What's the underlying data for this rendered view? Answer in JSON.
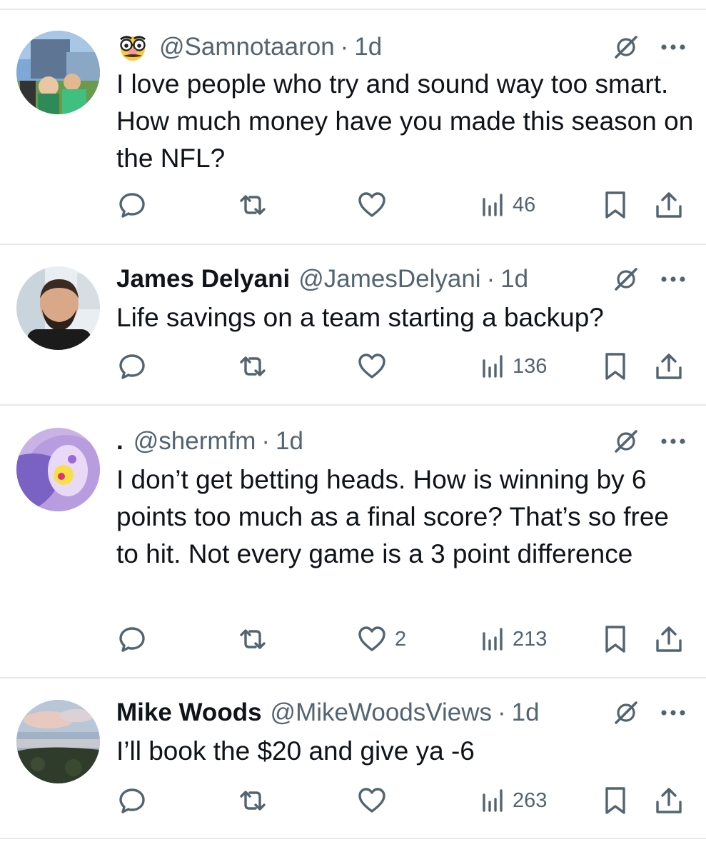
{
  "icons": {
    "reply": "reply-icon",
    "retweet": "retweet-icon",
    "like": "heart-icon",
    "views": "views-chart-icon",
    "bookmark": "bookmark-icon",
    "share": "share-icon",
    "grok": "grok-icon",
    "more": "more-icon"
  },
  "colors": {
    "text": "#0f1419",
    "secondary": "#536471",
    "divider": "#e6e9ec"
  },
  "tweets": [
    {
      "name": "",
      "handle": "@Samnotaaron",
      "dot": "·",
      "time": "1d",
      "text": "I love people who try and sound way too smart. How much money have you made this season on the NFL?",
      "likes": "",
      "views": "46",
      "name_prefix_icon": "disguise-face-emoji"
    },
    {
      "name": "James Delyani",
      "handle": "@JamesDelyani",
      "dot": "·",
      "time": "1d",
      "text": "Life savings on a team starting a backup?",
      "likes": "",
      "views": "136"
    },
    {
      "name": ".",
      "handle": "@shermfm",
      "dot": "·",
      "time": "1d",
      "text": "I don’t get betting heads. How is winning by 6 points too much as a final score? That’s so free to hit. Not every game is a 3 point difference",
      "likes": "2",
      "views": "213"
    },
    {
      "name": "Mike Woods",
      "handle": "@MikeWoodsViews",
      "dot": "·",
      "time": "1d",
      "text": "I’ll book the $20 and give ya -6",
      "likes": "",
      "views": "263"
    }
  ]
}
